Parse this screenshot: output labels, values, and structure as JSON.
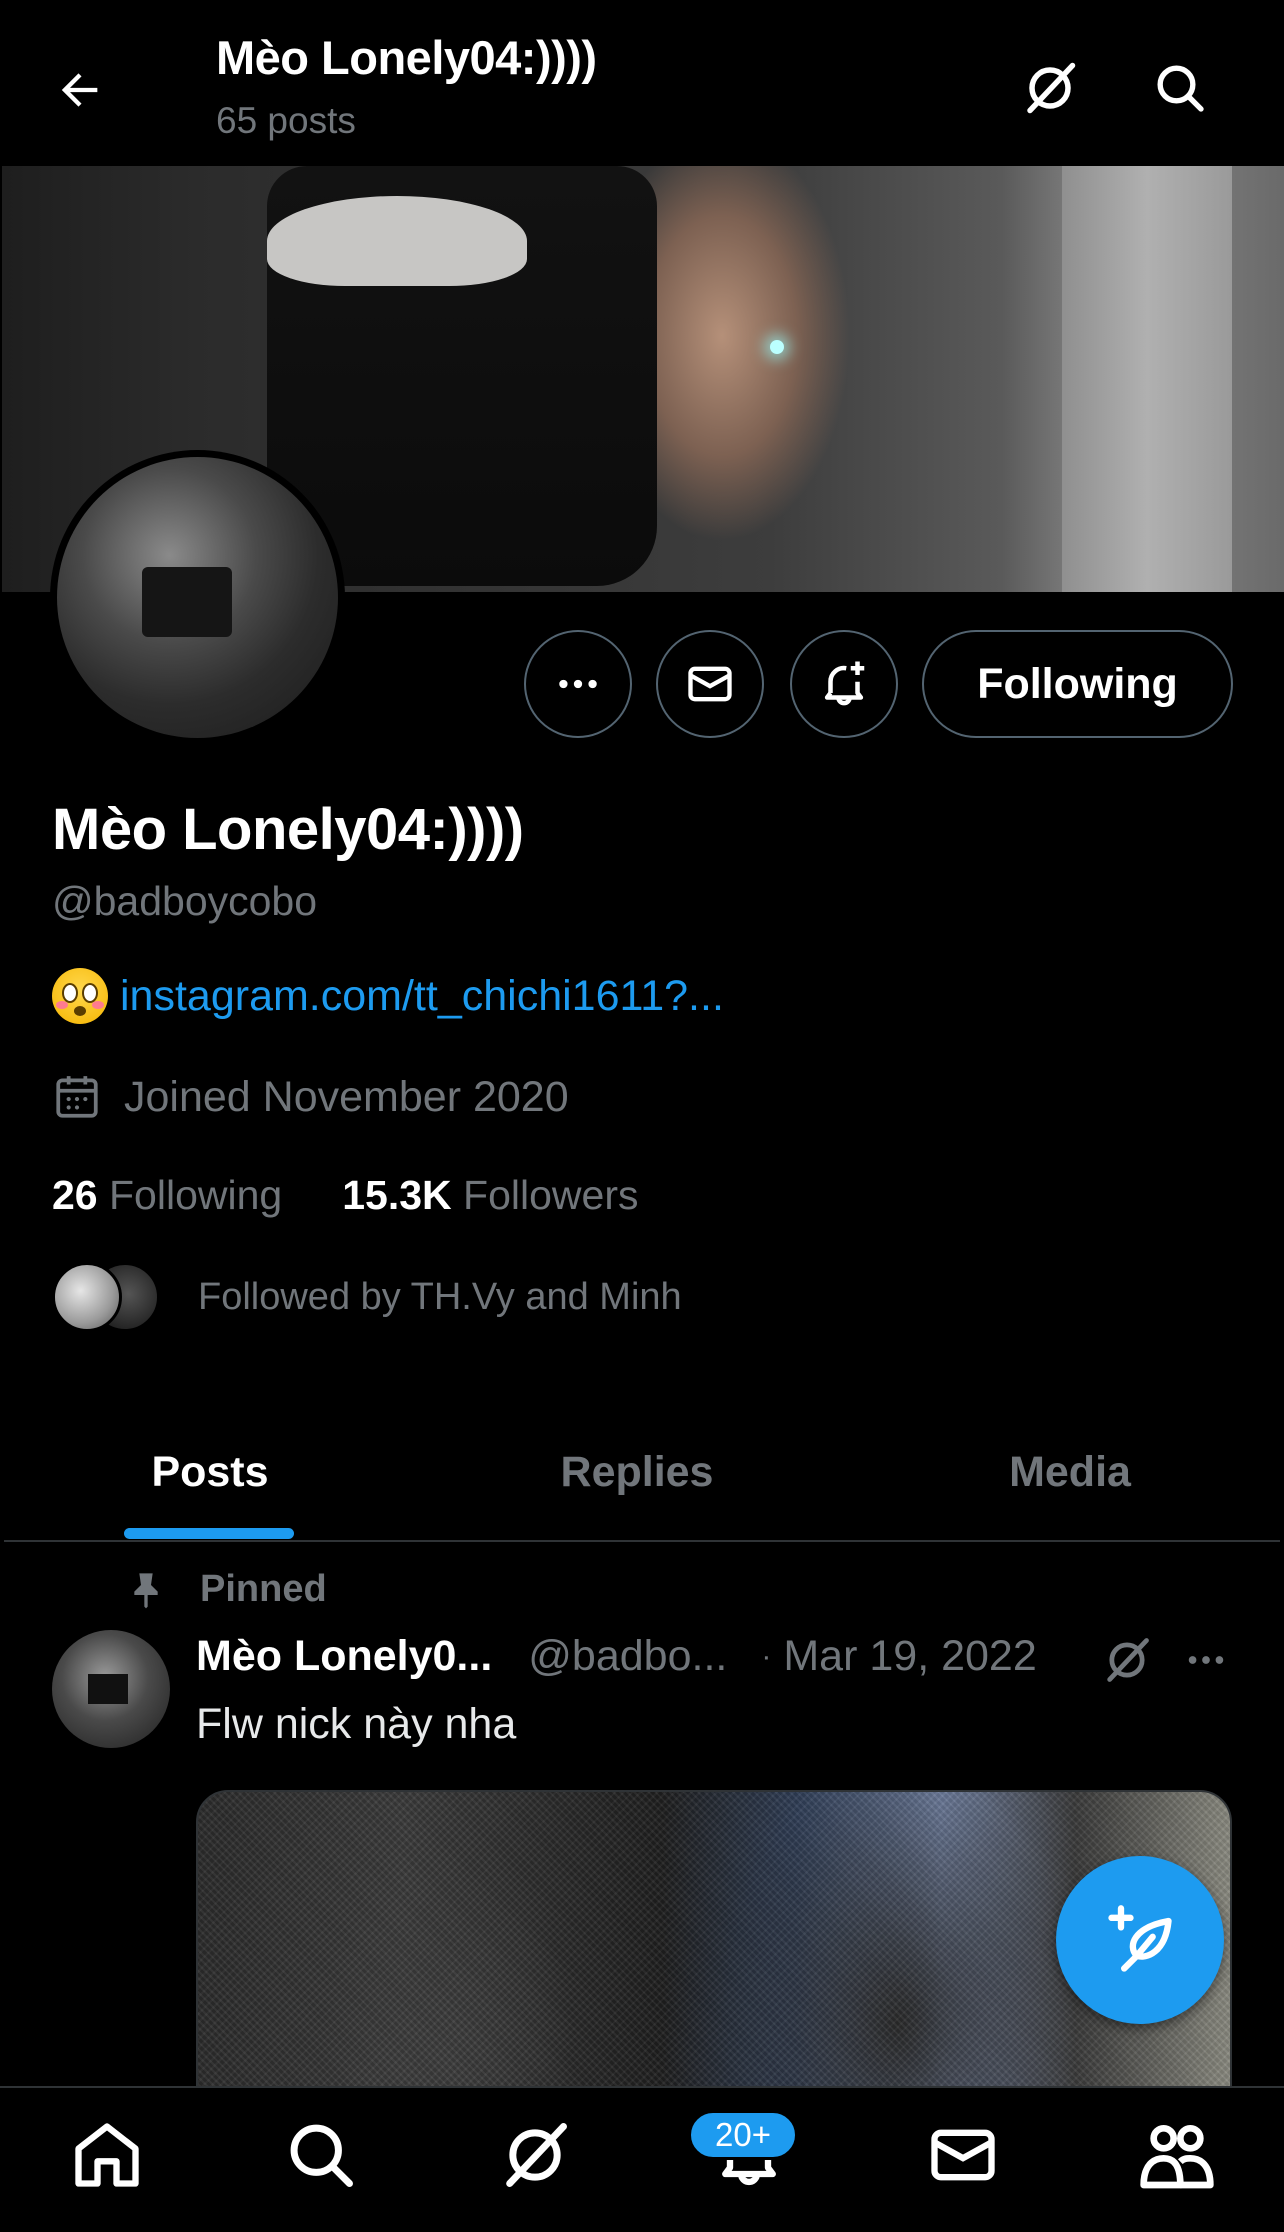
{
  "colors": {
    "accent": "#1d9bf0",
    "muted": "#71767b",
    "border": "#536471",
    "background": "#000000"
  },
  "header": {
    "title": "Mèo Lonely04:))))",
    "subtitle": "65 posts",
    "icons": [
      "back-arrow-icon",
      "grok-icon",
      "search-icon"
    ]
  },
  "actions": {
    "more_icon": "more-icon",
    "message_icon": "mail-icon",
    "notify_icon": "bell-plus-icon",
    "following_label": "Following"
  },
  "profile": {
    "name": "Mèo Lonely04:))))",
    "handle": "@badboycobo",
    "bio_emoji": "flushed-face-emoji",
    "bio_link": "instagram.com/tt_chichi1611?...",
    "joined": "Joined November 2020",
    "following_count": "26",
    "following_label": "Following",
    "followers_count": "15.3K",
    "followers_label": "Followers",
    "followed_by": "Followed by TH.Vy and Minh"
  },
  "tabs": [
    {
      "label": "Posts",
      "active": true
    },
    {
      "label": "Replies",
      "active": false
    },
    {
      "label": "Media",
      "active": false
    }
  ],
  "post": {
    "pinned_label": "Pinned",
    "author_name": "Mèo Lonely0...",
    "author_handle": "@badbo...",
    "separator": "·",
    "date": "Mar 19, 2022",
    "text": "Flw nick này nha"
  },
  "bottom_nav": {
    "items": [
      "home-icon",
      "search-icon",
      "grok-icon",
      "notifications-icon",
      "messages-icon",
      "communities-icon"
    ],
    "notifications_badge": "20+"
  }
}
